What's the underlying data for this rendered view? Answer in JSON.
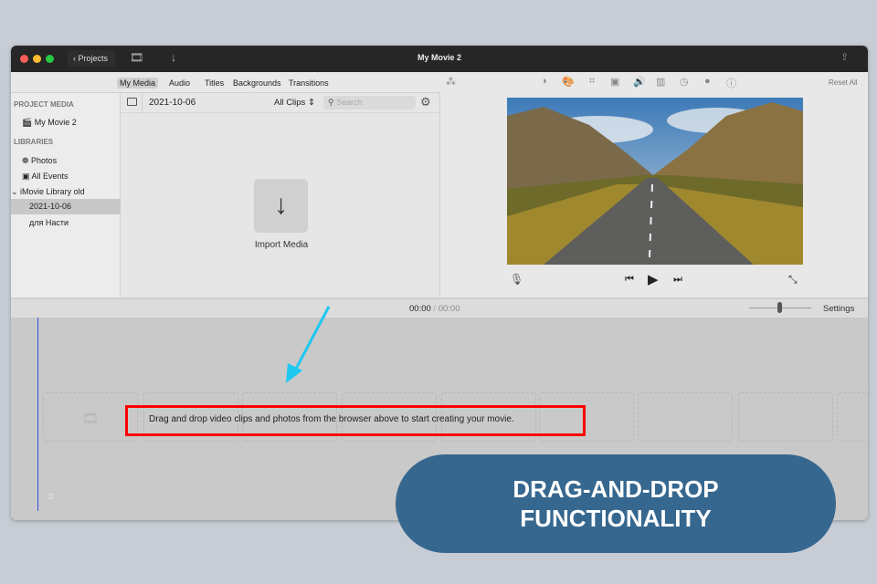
{
  "window": {
    "title": "My Movie 2",
    "back_button": "Projects"
  },
  "tabs": [
    "My Media",
    "Audio",
    "Titles",
    "Backgrounds",
    "Transitions"
  ],
  "sidebar": {
    "project_media_header": "PROJECT MEDIA",
    "project": "My Movie 2",
    "libraries_header": "LIBRARIES",
    "items": [
      "Photos",
      "All Events"
    ],
    "library": "iMovie Library old",
    "events": [
      "2021-10-06",
      "для Насти"
    ]
  },
  "browser": {
    "event_title": "2021-10-06",
    "filter": "All Clips",
    "search_placeholder": "Search",
    "import_label": "Import Media"
  },
  "viewer": {
    "reset_all": "Reset All"
  },
  "timeline": {
    "current_time": "00:00",
    "separator": "/",
    "total_time": "00:00",
    "settings": "Settings",
    "hint": "Drag and drop video clips and photos from the browser above to start creating your movie."
  },
  "banner": {
    "line1": "DRAG-AND-DROP",
    "line2": "FUNCTIONALITY"
  },
  "colors": {
    "highlight": "#ff0000",
    "arrow": "#1ec8f0",
    "banner": "#36678f"
  }
}
